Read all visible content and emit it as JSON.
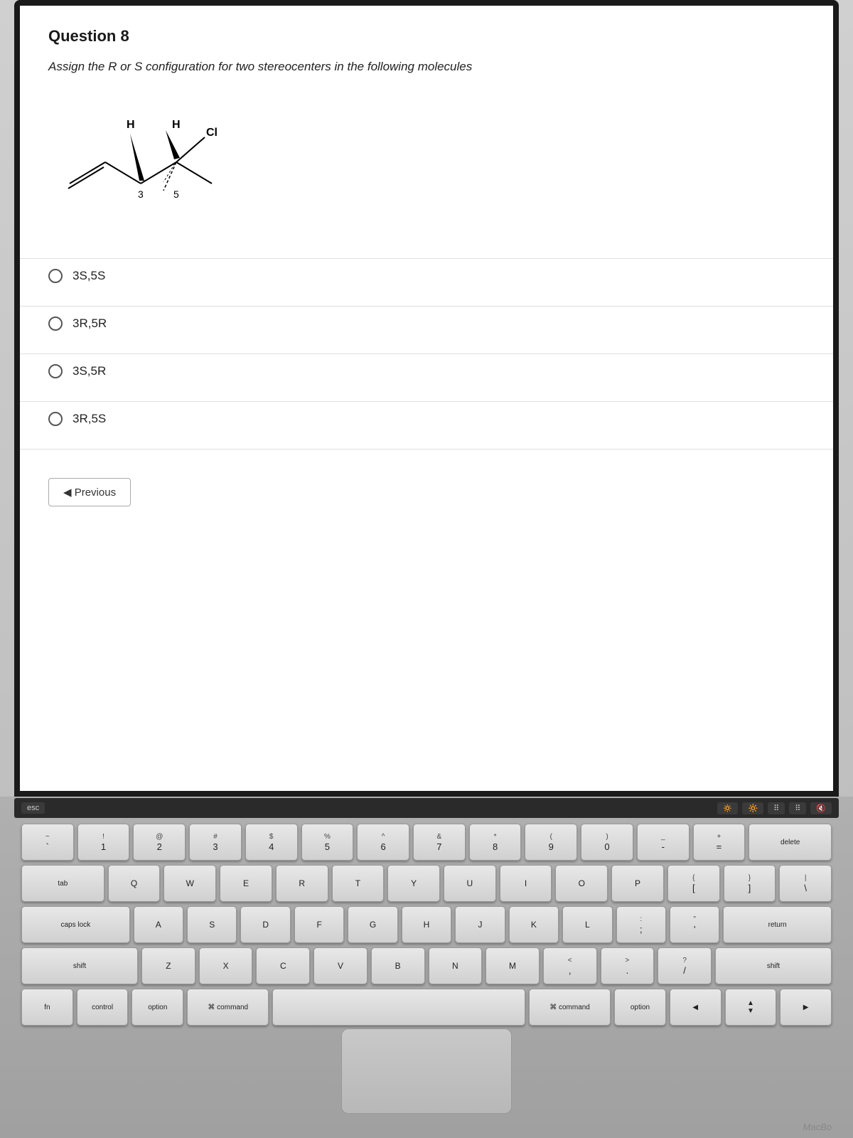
{
  "question": {
    "number": "Question 8",
    "text": "Assign the R or S configuration for two stereocenters in the following molecules",
    "choices": [
      {
        "id": "choice-1",
        "label": "3S,5S"
      },
      {
        "id": "choice-2",
        "label": "3R,5R"
      },
      {
        "id": "choice-3",
        "label": "3S,5R"
      },
      {
        "id": "choice-4",
        "label": "3R,5S"
      }
    ],
    "previous_button": "◀ Previous"
  },
  "keyboard": {
    "touchbar_keys": [
      "esc",
      "F1",
      "F2",
      "F3",
      "F4",
      "F5",
      "F6"
    ],
    "row1": [
      "~`",
      "!1",
      "@2",
      "#3",
      "$4",
      "%5",
      "^6",
      "&7",
      "*8",
      "(9",
      ")0",
      "_-",
      "+=",
      "delete"
    ],
    "row2": [
      "tab",
      "Q",
      "W",
      "E",
      "R",
      "T",
      "Y",
      "U",
      "I",
      "O",
      "P",
      "{[",
      "}]",
      "|\\"
    ],
    "row3": [
      "caps",
      "A",
      "S",
      "D",
      "F",
      "G",
      "H",
      "J",
      "K",
      "L",
      ":;",
      "\"'",
      "return"
    ],
    "row4": [
      "shift",
      "Z",
      "X",
      "C",
      "V",
      "B",
      "N",
      "M",
      "<,",
      ">.",
      "?/",
      "shift"
    ],
    "row5": [
      "fn",
      "ctrl",
      "opt",
      "cmd",
      "space",
      "cmd",
      "opt",
      "◀",
      "▼▲",
      "▶"
    ]
  },
  "macbook_brand": "MacBo"
}
